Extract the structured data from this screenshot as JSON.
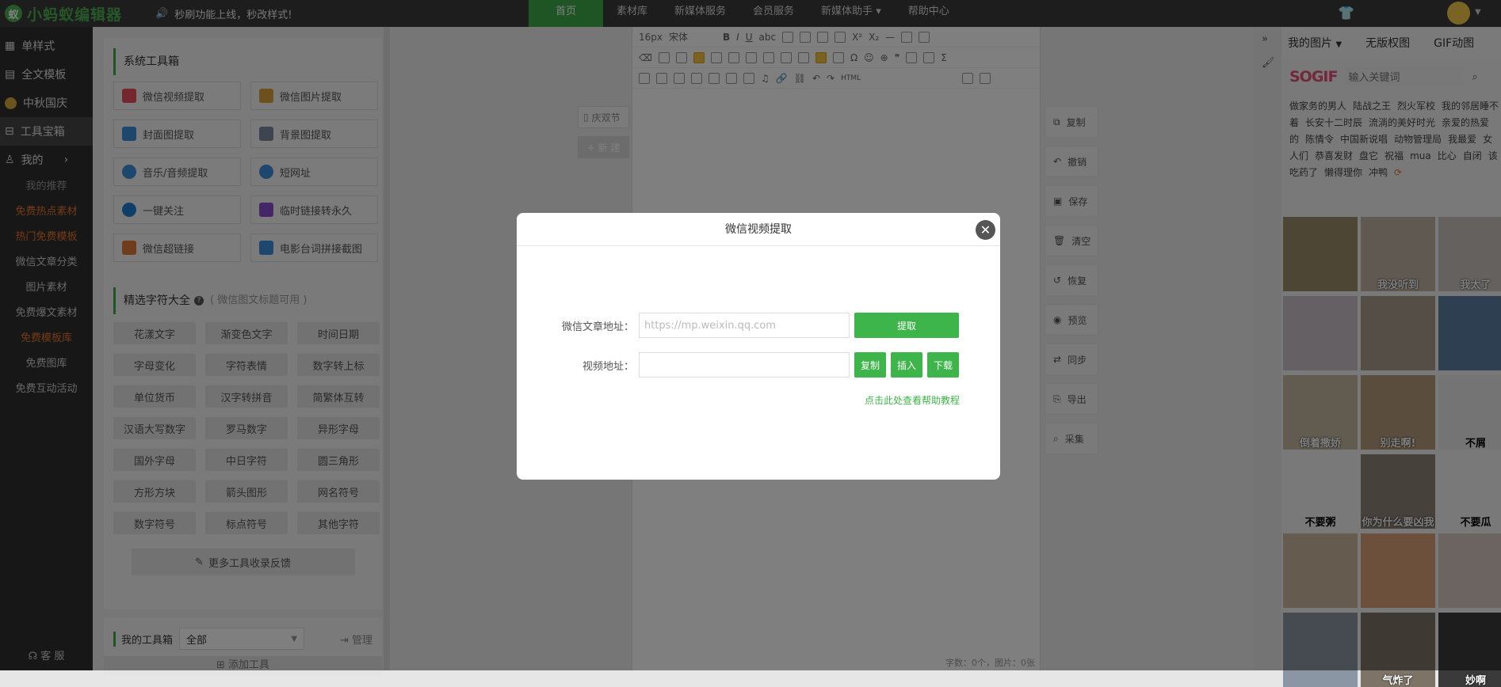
{
  "header": {
    "logo_text": "小蚂蚁编辑器",
    "announcement": "秒刷功能上线，秒改样式!",
    "nav": [
      "首页",
      "素材库",
      "新媒体服务",
      "会员服务",
      "新媒体助手",
      "帮助中心"
    ],
    "nav_dropdown_caret": "▾"
  },
  "leftnav": {
    "main_items": [
      "单样式",
      "全文模板",
      "中秋国庆",
      "工具宝箱",
      "我的"
    ],
    "sub_items": [
      {
        "label": "我的推荐",
        "style": "gray"
      },
      {
        "label": "免费热点素材",
        "style": "orange"
      },
      {
        "label": "热门免费模板",
        "style": "orange"
      },
      {
        "label": "微信文章分类",
        "style": "normal"
      },
      {
        "label": "图片素材",
        "style": "normal"
      },
      {
        "label": "免费爆文素材",
        "style": "normal"
      },
      {
        "label": "免费模板库",
        "style": "orange"
      },
      {
        "label": "免费图库",
        "style": "normal"
      },
      {
        "label": "免费互动活动",
        "style": "normal"
      }
    ],
    "service": "客 服"
  },
  "toolbox": {
    "title": "系统工具箱",
    "tools": [
      "微信视频提取",
      "微信图片提取",
      "封面图提取",
      "背景图提取",
      "音乐/音频提取",
      "短网址",
      "一键关注",
      "临时链接转永久",
      "微信超链接",
      "电影台词拼接截图"
    ],
    "tool_colors": [
      "#e94e5a",
      "#d9a13a",
      "#3b8fd8",
      "#7a8aa0",
      "#3b8fd8",
      "#3b8fd8",
      "#1f7fd1",
      "#8b4fd0",
      "#e07b39",
      "#3b8fd8"
    ]
  },
  "chars": {
    "title": "精选字符大全",
    "hint": "( 微信图文标题可用 )",
    "items": [
      "花漾文字",
      "渐变色文字",
      "时间日期",
      "字母变化",
      "字符表情",
      "数字转上标",
      "单位货币",
      "汉字转拼音",
      "简繁体互转",
      "汉语大写数字",
      "罗马数字",
      "异形字母",
      "国外字母",
      "中日字符",
      "圆三角形",
      "方形方块",
      "箭头图形",
      "网名符号",
      "数字符号",
      "标点符号",
      "其他字符"
    ],
    "more": "更多工具收录反馈"
  },
  "mytoolbox": {
    "title": "我的工具箱",
    "select_value": "全部",
    "manage": "管理",
    "add": "添加工具"
  },
  "editor": {
    "font_size": "16px",
    "font_family": "宋体",
    "html_label": "HTML",
    "status": "字数：0个，图片：0张",
    "tag_chip": "庆双节",
    "new_chip": "+ 新 建"
  },
  "side_actions": [
    "复制",
    "撤销",
    "保存",
    "清空",
    "恢复",
    "预览",
    "同步",
    "导出",
    "采集"
  ],
  "rightpanel": {
    "tabs": [
      "我的图片",
      "无版权图",
      "GIF动图"
    ],
    "logo": "SOGIF",
    "search_placeholder": "输入关键词",
    "tags": [
      "做家务的男人",
      "陆战之王",
      "烈火军校",
      "我的邻居睡不着",
      "长安十二时辰",
      "流淌的美好时光",
      "亲爱的热爱的",
      "陈情令",
      "中国新说唱",
      "动物管理局",
      "我最爱",
      "女人们",
      "恭喜发财",
      "盘它",
      "祝福",
      "mua",
      "比心",
      "自闭",
      "该吃药了",
      "懒得理你",
      "冲鸭"
    ],
    "gif_captions": [
      "",
      "我没听到",
      "我太了",
      "",
      "",
      "",
      "倒着撒娇",
      "别走啊!",
      "不屑",
      "不要粥",
      "你为什么要凶我",
      "不要瓜",
      "",
      "",
      "",
      "",
      "气炸了",
      "妙啊"
    ]
  },
  "modal": {
    "title": "微信视频提取",
    "article_label": "微信文章地址：",
    "article_placeholder": "https://mp.weixin.qq.com",
    "extract": "提取",
    "video_label": "视频地址：",
    "copy": "复制",
    "insert": "插入",
    "download": "下载",
    "help": "点击此处查看帮助教程"
  }
}
